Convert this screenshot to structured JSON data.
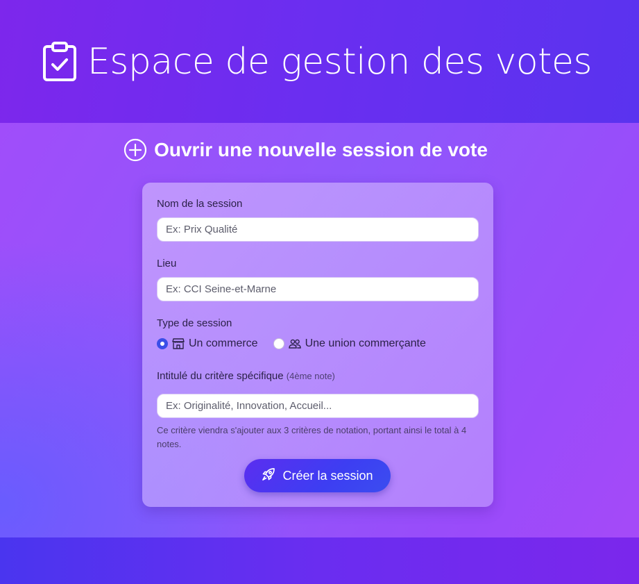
{
  "header": {
    "title": "Espace de gestion des votes",
    "icon": "clipboard-check-icon"
  },
  "form_section": {
    "title": "Ouvrir une nouvelle session de vote",
    "icon": "plus-circle-icon"
  },
  "form": {
    "session_name": {
      "label": "Nom de la session",
      "placeholder": "Ex: Prix Qualité",
      "value": ""
    },
    "location": {
      "label": "Lieu",
      "placeholder": "Ex: CCI Seine-et-Marne",
      "value": ""
    },
    "session_type": {
      "label": "Type de session",
      "options": [
        {
          "label": "Un commerce",
          "icon": "shop-icon",
          "selected": true
        },
        {
          "label": "Une union commerçante",
          "icon": "people-icon",
          "selected": false
        }
      ]
    },
    "criterion": {
      "label": "Intitulé du critère spécifique",
      "hint": "(4ème note)",
      "placeholder": "Ex: Originalité, Innovation, Accueil...",
      "value": "",
      "help": "Ce critère viendra s'ajouter aux 3 critères de notation, portant ainsi le total à 4 notes."
    },
    "submit": {
      "label": "Créer la session",
      "icon": "rocket-icon"
    }
  },
  "colors": {
    "accent": "#3a4ee8",
    "header_bg": "#6a2ef0",
    "main_bg": "#9a4bfa",
    "button_bg": "#3d3ef2"
  }
}
